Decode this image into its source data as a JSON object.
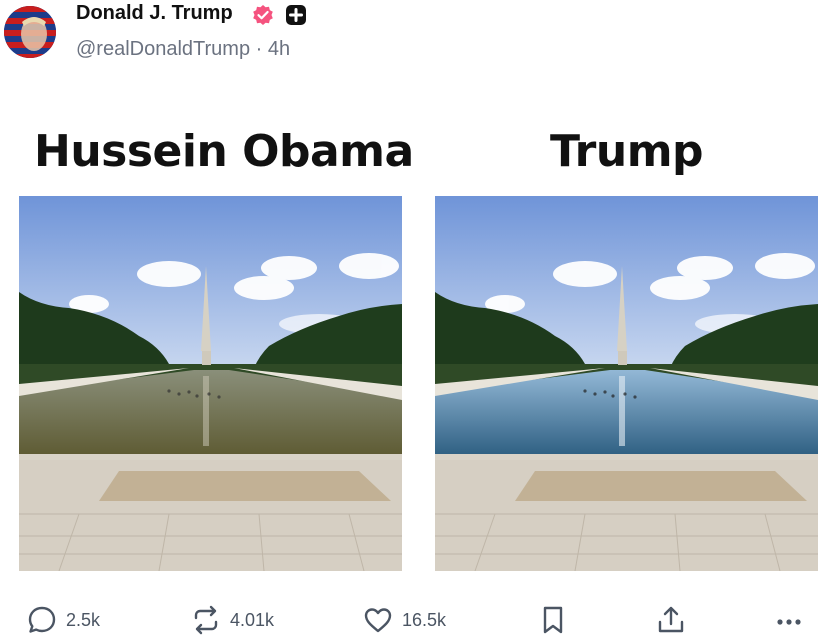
{
  "post": {
    "author_name": "Donald J. Trump",
    "handle": "@realDonaldTrump",
    "separator": "·",
    "time": "4h"
  },
  "meme": {
    "left_title": "Hussein Obama",
    "right_title": "Trump"
  },
  "actions": {
    "replies": "2.5k",
    "reposts": "4.01k",
    "likes": "16.5k"
  },
  "icons": [
    "verified-badge-icon",
    "plus-badge-icon",
    "reply-icon",
    "repost-icon",
    "like-icon",
    "bookmark-icon",
    "share-icon",
    "more-icon"
  ],
  "colors": {
    "verified": "#f5537f",
    "text_muted": "#6b7280",
    "water_left": "#6b6a3e",
    "water_right": "#3f6f8f"
  }
}
